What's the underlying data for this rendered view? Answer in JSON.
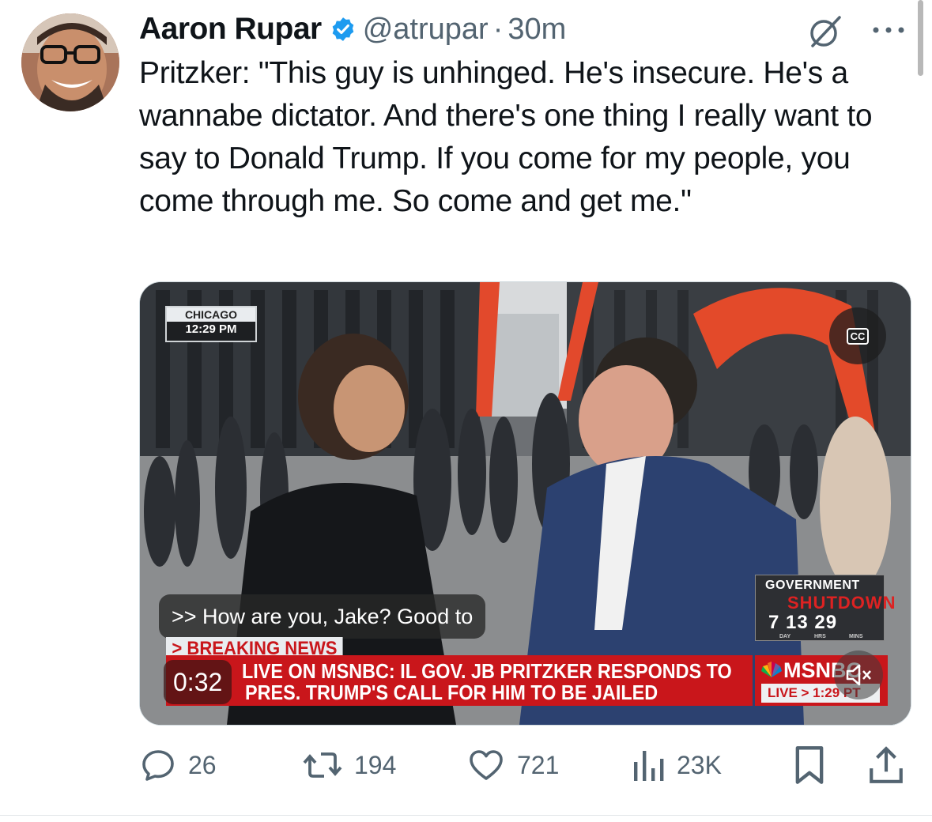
{
  "tweet": {
    "author_name": "Aaron Rupar",
    "handle": "@atrupar",
    "separator": "·",
    "time_ago": "30m",
    "text": "Pritzker: \"This guy is unhinged. He's insecure. He's a wannabe dictator. And there's one thing I really want to say to Donald Trump. If you come for my people, you come through me. So come and get me.\""
  },
  "video": {
    "location_city": "CHICAGO",
    "location_time": "12:29 PM",
    "cc_label": "CC",
    "caption": ">> How are you, Jake? Good to",
    "breaking_tag": "> BREAKING NEWS",
    "headline_line1": "LIVE ON MSNBC: IL GOV. JB PRITZKER RESPONDS TO",
    "headline_line2": "PRES. TRUMP'S CALL FOR HIM TO BE JAILED",
    "duration": "0:32",
    "shutdown_title": "GOVERNMENT",
    "shutdown_word": "SHUTDOWN",
    "shutdown_counter": "7  13 29",
    "shutdown_day": "DAY",
    "shutdown_hrs": "HRS",
    "shutdown_mins": "MINS",
    "network": "MSNBC",
    "live_label": "LIVE  >  1:29 PT"
  },
  "actions": {
    "replies": "26",
    "reposts": "194",
    "likes": "721",
    "views": "23K"
  },
  "colors": {
    "verified": "#1d9bf0",
    "icon_gray": "#536471",
    "msnbc_red": "#c9161b"
  },
  "icons": [
    "verified-badge-icon",
    "grok-icon",
    "more-icon",
    "closed-captions-icon",
    "mute-icon",
    "reply-icon",
    "repost-icon",
    "like-icon",
    "views-icon",
    "bookmark-icon",
    "share-icon"
  ]
}
